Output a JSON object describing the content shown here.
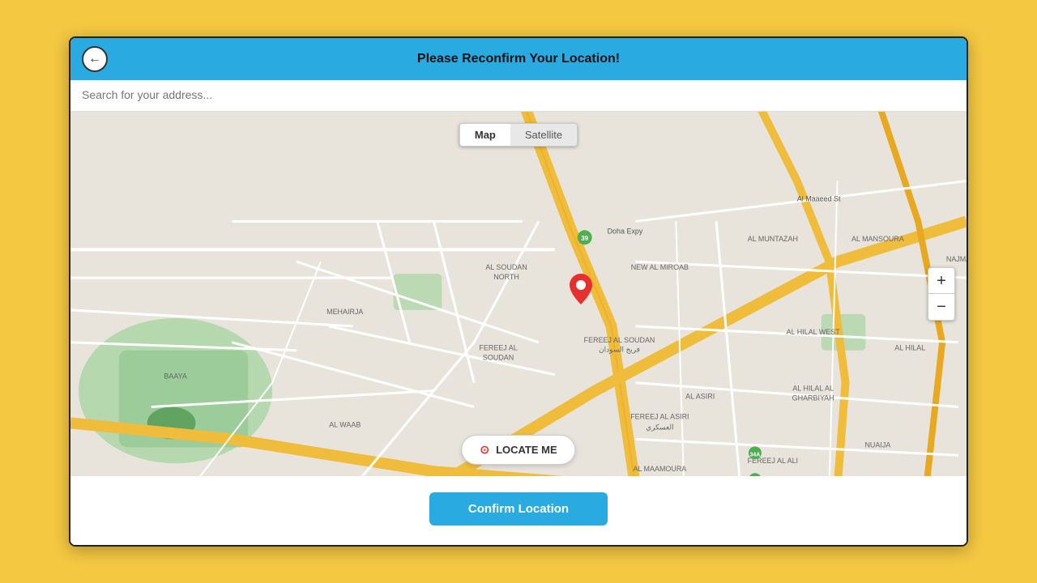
{
  "header": {
    "title": "Please Reconfirm Your Location!",
    "back_label": "←"
  },
  "search": {
    "placeholder": "Search for your address..."
  },
  "map": {
    "toggle": {
      "map_label": "Map",
      "satellite_label": "Satellite",
      "active": "Map"
    },
    "locate_me_label": "LOCATE ME",
    "zoom_in_label": "+",
    "zoom_out_label": "−"
  },
  "footer": {
    "confirm_label": "Confirm Location"
  },
  "colors": {
    "header_bg": "#29ABE2",
    "confirm_btn": "#29ABE2",
    "body_bg": "#F5C842",
    "marker": "#e63030",
    "road_main": "#F0BC3C",
    "road_secondary": "#ffffff",
    "map_bg": "#E4E0D8",
    "map_green": "#A8D5A2"
  }
}
